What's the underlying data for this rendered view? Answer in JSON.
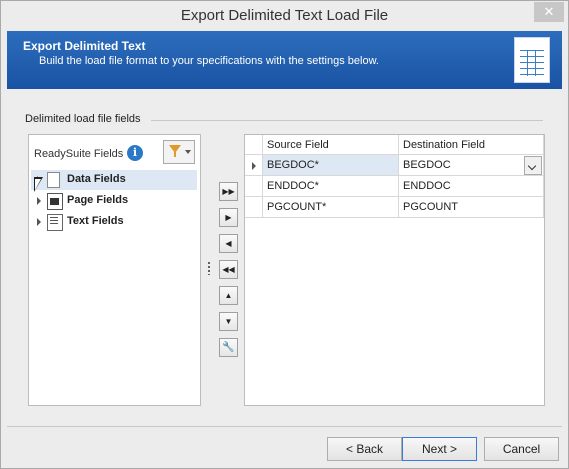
{
  "window": {
    "title": "Export Delimited Text Load File",
    "close_glyph": "✕"
  },
  "banner": {
    "title": "Export Delimited Text",
    "subtitle": "Build the load file format to your specifications with the settings below."
  },
  "fields_group": {
    "label": "Delimited load file fields"
  },
  "left_panel": {
    "header_label": "ReadySuite Fields",
    "info_glyph": "i",
    "tree": [
      {
        "label": "Data Fields",
        "icon": "document-icon",
        "selected": true
      },
      {
        "label": "Page Fields",
        "icon": "image-icon",
        "selected": false
      },
      {
        "label": "Text Fields",
        "icon": "text-document-icon",
        "selected": false
      }
    ]
  },
  "move_buttons": [
    {
      "name": "add-all-button",
      "glyph": "▶▶"
    },
    {
      "name": "add-button",
      "glyph": "▶"
    },
    {
      "name": "remove-button",
      "glyph": "◀"
    },
    {
      "name": "remove-all-button",
      "glyph": "◀◀"
    },
    {
      "name": "move-up-button",
      "glyph": "▲"
    },
    {
      "name": "move-down-button",
      "glyph": "▼"
    },
    {
      "name": "settings-wrench-button",
      "glyph": "🔧"
    }
  ],
  "grid": {
    "columns": [
      "Source Field",
      "Destination Field"
    ],
    "rows": [
      {
        "source": "BEGDOC*",
        "destination": "BEGDOC",
        "current": true
      },
      {
        "source": "ENDDOC*",
        "destination": "ENDDOC",
        "current": false
      },
      {
        "source": "PGCOUNT*",
        "destination": "PGCOUNT",
        "current": false
      }
    ]
  },
  "footer": {
    "back": "< Back",
    "next": "Next >",
    "cancel": "Cancel"
  }
}
